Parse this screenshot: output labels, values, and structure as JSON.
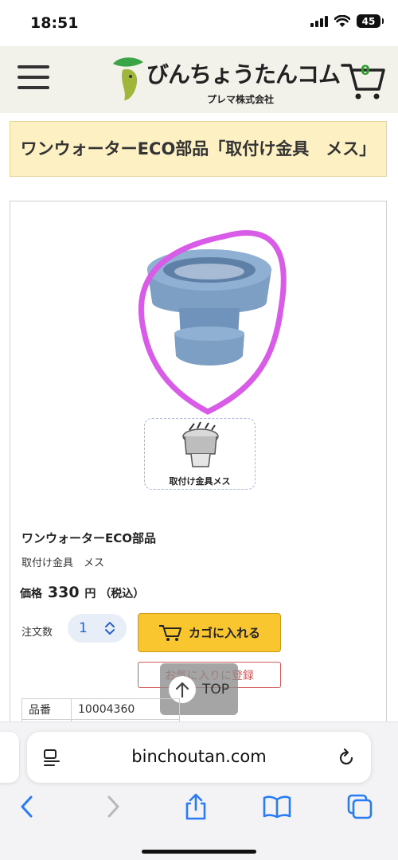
{
  "status_bar": {
    "time": "18:51",
    "battery_level": "45",
    "icons": [
      "signal-icon",
      "wifi-icon",
      "battery-icon"
    ]
  },
  "header": {
    "logo_text": "びんちょうたんコム",
    "logo_company": "プレマ株式会社",
    "cart_count": "0",
    "icons": [
      "menu-icon",
      "cart-icon"
    ]
  },
  "product": {
    "page_title": "ワンウォーターECO部品「取付け金具　メス」",
    "thumbnail_caption": "取付け金具メス",
    "name": "ワンウォーターECO部品",
    "subtitle": "取付け金具　メス",
    "price_label": "価格",
    "price_value": "330",
    "price_unit": "円",
    "tax_note": "（税込）",
    "quantity_label": "注文数",
    "quantity_value": "1",
    "add_to_cart_label": "カゴに入れる",
    "favorite_label": "お気に入りに登録",
    "spec": {
      "key": "品番",
      "value": "10004360"
    }
  },
  "scroll_top": {
    "label": "TOP"
  },
  "browser": {
    "url": "binchoutan.com",
    "icons": [
      "reader-icon",
      "reload-icon",
      "back-icon",
      "forward-icon",
      "share-icon",
      "bookmarks-icon",
      "tabs-icon"
    ]
  },
  "colors": {
    "header_bg": "#f2f1ea",
    "title_bg": "#fdf1c4",
    "cart_button": "#f9c630",
    "favorite_red": "#d25656",
    "ios_blue": "#2a7bf6",
    "highlight_circle": "#d95ce8",
    "part_blue": "#7d9fc4"
  }
}
